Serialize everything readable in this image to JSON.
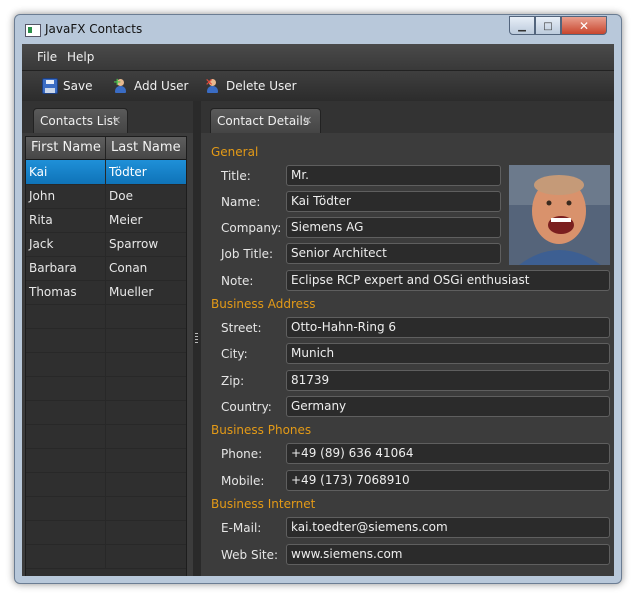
{
  "window": {
    "title": "JavaFX Contacts"
  },
  "menu": [
    "File",
    "Help"
  ],
  "toolbar": {
    "save": "Save",
    "add_user": "Add User",
    "delete_user": "Delete User"
  },
  "left_tab": {
    "label": "Contacts List",
    "close": "✕"
  },
  "right_tab": {
    "label": "Contact Details",
    "close": "✕"
  },
  "table": {
    "headers": [
      "First Name",
      "Last Name"
    ],
    "rows": [
      [
        "Kai",
        "Tödter"
      ],
      [
        "John",
        "Doe"
      ],
      [
        "Rita",
        "Meier"
      ],
      [
        "Jack",
        "Sparrow"
      ],
      [
        "Barbara",
        "Conan"
      ],
      [
        "Thomas",
        "Mueller"
      ]
    ],
    "selected_row": 0
  },
  "details": {
    "sections": {
      "general": "General",
      "business_address": "Business Address",
      "business_phones": "Business Phones",
      "business_internet": "Business Internet"
    },
    "labels": {
      "title": "Title:",
      "name": "Name:",
      "company": "Company:",
      "job_title": "Job Title:",
      "note": "Note:",
      "street": "Street:",
      "city": "City:",
      "zip": "Zip:",
      "country": "Country:",
      "phone": "Phone:",
      "mobile": "Mobile:",
      "email": "E-Mail:",
      "website": "Web Site:"
    },
    "values": {
      "title": "Mr.",
      "name": "Kai Tödter",
      "company": "Siemens AG",
      "job_title": "Senior Architect",
      "note": "Eclipse RCP expert and OSGi enthusiast",
      "street": "Otto-Hahn-Ring 6",
      "city": "Munich",
      "zip": "81739",
      "country": "Germany",
      "phone": "+49 (89) 636 41064",
      "mobile": "+49 (173) 7068910",
      "email": "kai.toedter@siemens.com",
      "website": "www.siemens.com"
    }
  },
  "colors": {
    "accent": "#E39A17",
    "selection": "#1A88D0",
    "background": "#3C3C3C"
  },
  "icons": [
    "app-icon",
    "save-icon",
    "add-user-icon",
    "delete-user-icon",
    "close-icon"
  ]
}
